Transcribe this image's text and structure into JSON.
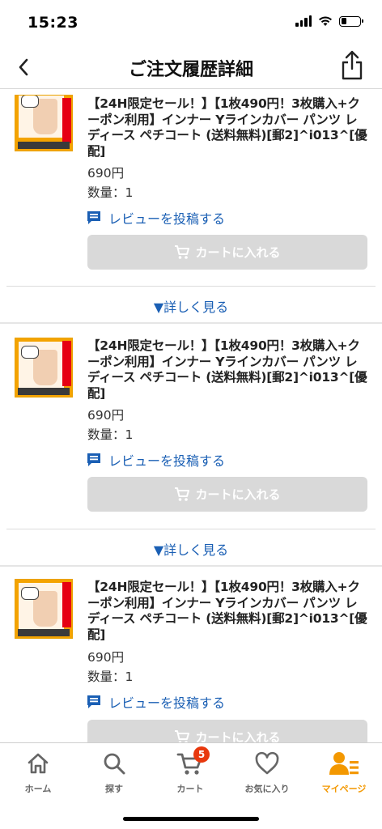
{
  "status": {
    "time": "15:23"
  },
  "nav": {
    "title": "ご注文履歴詳細"
  },
  "items": [
    {
      "title": "【24H限定セール！】【1枚490円！3枚購入+クーポン利用】インナー Yラインカバー パンツ レディース ペチコート (送料無料)[郵2]^i013^[優配]",
      "price": "690円",
      "quantity": "数量：1",
      "review_label": "レビューを投稿する",
      "cart_label": "カートに入れる",
      "more_label": "▼詳しく見る"
    },
    {
      "title": "【24H限定セール！】【1枚490円！3枚購入+クーポン利用】インナー Yラインカバー パンツ レディース ペチコート (送料無料)[郵2]^i013^[優配]",
      "price": "690円",
      "quantity": "数量：1",
      "review_label": "レビューを投稿する",
      "cart_label": "カートに入れる",
      "more_label": "▼詳しく見る"
    },
    {
      "title": "【24H限定セール！】【1枚490円！3枚購入+クーポン利用】インナー Yラインカバー パンツ レディース ペチコート (送料無料)[郵2]^i013^[優配]",
      "price": "690円",
      "quantity": "数量：1",
      "review_label": "レビューを投稿する",
      "cart_label": "カートに入れる"
    }
  ],
  "tabs": [
    {
      "label": "ホーム",
      "icon": "home-icon"
    },
    {
      "label": "探す",
      "icon": "search-icon"
    },
    {
      "label": "カート",
      "icon": "cart-icon",
      "badge": "5"
    },
    {
      "label": "お気に入り",
      "icon": "heart-icon"
    },
    {
      "label": "マイページ",
      "icon": "mypage-icon",
      "active": true
    }
  ],
  "colors": {
    "accent": "#f39800",
    "link": "#1a5fb4",
    "badge": "#e8380d",
    "disabled_button": "#d9d9d9"
  }
}
